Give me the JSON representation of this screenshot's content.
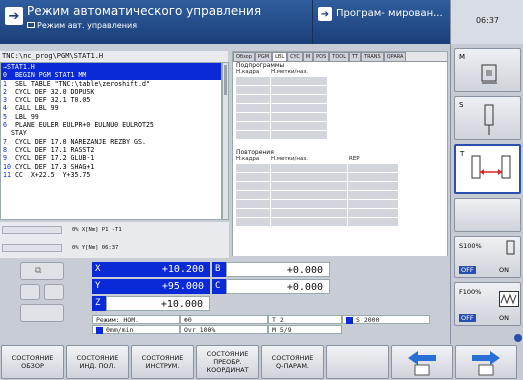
{
  "header": {
    "mode_title": "Режим автоматического управления",
    "mode_subtitle": "Режим авт. управления",
    "mode2_title": "Програм- мирован...",
    "clock": "06:37"
  },
  "program": {
    "path": "TNC:\\nc_prog\\PGM\\STAT1.H",
    "title": "→STAT1.H",
    "lines": [
      {
        "n": "0",
        "text": "BEGIN PGM STAT1 MM",
        "selected": true
      },
      {
        "n": "1",
        "text": "SEL TABLE \"TNC:\\table\\zeroshift.d\""
      },
      {
        "n": "2",
        "text": "CYCL DEF 32.0 DOPUSK"
      },
      {
        "n": "3",
        "text": "CYCL DEF 32.1 T0.05"
      },
      {
        "n": "4",
        "text": "CALL LBL 99"
      },
      {
        "n": "5",
        "text": "LBL 99"
      },
      {
        "n": "6",
        "text": "PLANE EULER EULPR+0 EULNU0 EULROT25"
      },
      {
        "n": "",
        "text": "STAY"
      },
      {
        "n": "7",
        "text": "CYCL DEF 17.0 NAREZANJE REZBY GS."
      },
      {
        "n": "8",
        "text": "CYCL DEF 17.1 RASST2"
      },
      {
        "n": "9",
        "text": "CYCL DEF 17.2 GLUB-1"
      },
      {
        "n": "10",
        "text": "CYCL DEF 17.3 SHAG+1"
      },
      {
        "n": "11",
        "text": "CC  X+22.5  Y+35.75"
      }
    ]
  },
  "status": {
    "tabs": [
      "Обзор",
      "PGM",
      "LBL",
      "CYC",
      "M",
      "POS",
      "TOOL",
      "TT",
      "TRANS",
      "QPARA"
    ],
    "active_tab": "LBL",
    "subprograms_title": "Подпрограммы",
    "subprograms_cols": [
      "Н.кадра",
      "Н.метки/наз."
    ],
    "repeats_title": "Повторения",
    "repeats_cols": [
      "Н.кадра",
      "Н.метки/наз.",
      "REP"
    ]
  },
  "progress": {
    "bar1_label": "0% X[Nm] P1  -T1",
    "bar2_label": "0% Y[Nm] 06:37"
  },
  "position": {
    "axes": [
      {
        "axis": "X",
        "value": "+10.200"
      },
      {
        "axis": "Y",
        "value": "+95.000"
      },
      {
        "axis": "Z",
        "value": "+10.000"
      }
    ],
    "axes2": [
      {
        "axis": "B",
        "value": "+0.000"
      },
      {
        "axis": "C",
        "value": "+0.000"
      }
    ],
    "mode_label": "Режим: НОМ.",
    "f_value": "0mm/min",
    "tool_icon_value": "0",
    "ovr": "Ovr 100%",
    "t_value": "T 2",
    "s_value": "S 2000",
    "m_value": "M 5/9"
  },
  "right_panel": {
    "s100": "S100%",
    "f100": "F100%",
    "off": "OFF",
    "on": "ON",
    "m_label": "M",
    "s_label": "S",
    "t_label": "T"
  },
  "softkeys": [
    "СОСТОЯНИЕ\nОБЗОР",
    "СОСТОЯНИЕ\nИНД. ПОЛ.",
    "СОСТОЯНИЕ\nИНСТРУМ.",
    "СОСТОЯНИЕ\nПРЕОБР.\nКООРДИНАТ",
    "СОСТОЯНИЕ\nQ-ПАРАМ.",
    "",
    "",
    ""
  ]
}
